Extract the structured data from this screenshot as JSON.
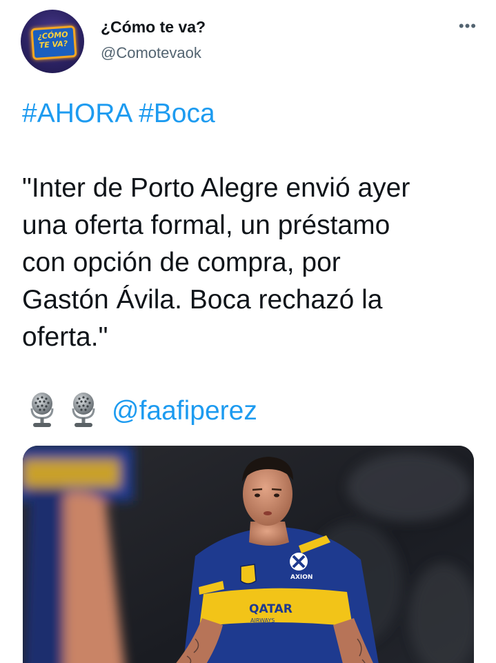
{
  "tweet": {
    "author": {
      "name": "¿Cómo te va?",
      "handle": "@Comotevaok",
      "avatar_text_line1": "¿CÓMO",
      "avatar_text_line2": "TE VA?"
    },
    "more_icon": "more-dots-icon",
    "more_label": "•••",
    "hashtags": [
      "#AHORA",
      "#Boca"
    ],
    "quote": "\"Inter de Porto Alegre envió ayer\nuna oferta formal, un préstamo\ncon opción de compra, por\nGastón Ávila. Boca rechazó la\noferta.\"",
    "source_icons": [
      "microphone-icon",
      "microphone-icon"
    ],
    "mention": "@faafiperez",
    "media": {
      "description_icon": "photo",
      "jersey_sponsor_text": "QATAR AIRWAYS",
      "jersey_logo_text": "AXION energy"
    },
    "colors": {
      "link": "#1d9bf0",
      "text": "#0f1419",
      "secondary": "#536471",
      "boca_blue": "#1e3a8f",
      "boca_yellow": "#f2c418"
    }
  }
}
